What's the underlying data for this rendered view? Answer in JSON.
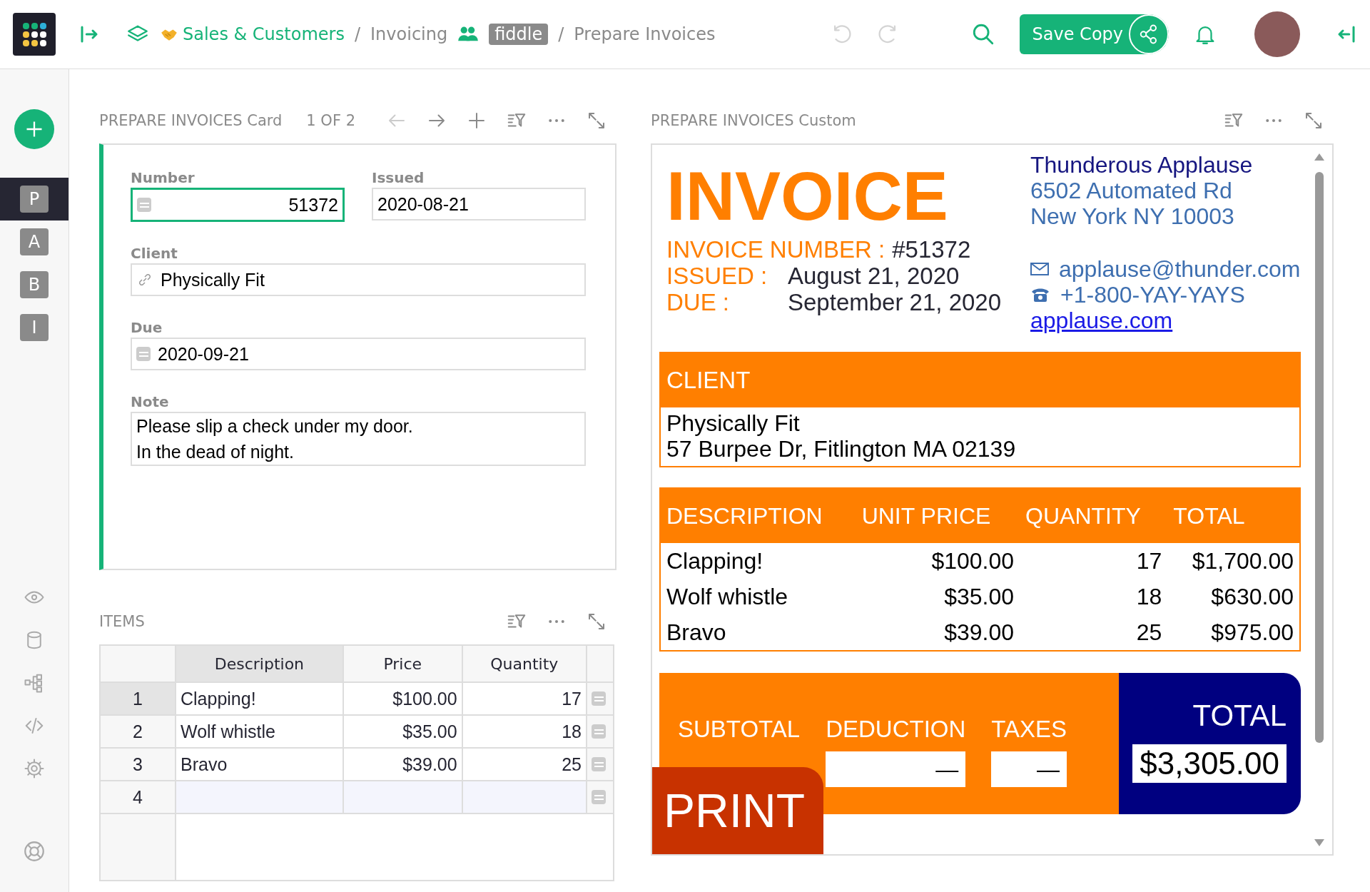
{
  "topbar": {
    "breadcrumb": [
      {
        "kind": "site",
        "text": "Sales & Customers"
      },
      {
        "kind": "separator",
        "text": "/"
      },
      {
        "kind": "link",
        "text": "Invoicing"
      },
      {
        "kind": "workspace",
        "text": "fiddle"
      },
      {
        "kind": "separator",
        "text": "/"
      },
      {
        "kind": "page",
        "text": "Prepare Invoices"
      }
    ],
    "undo_disabled": true,
    "redo_disabled": true,
    "save_button": "Save Copy"
  },
  "sidebar": {
    "pages": [
      {
        "letter": "P",
        "selected": true
      },
      {
        "letter": "A",
        "selected": false
      },
      {
        "letter": "B",
        "selected": false
      },
      {
        "letter": "I",
        "selected": false
      }
    ]
  },
  "card": {
    "title": "PREPARE INVOICES Card",
    "counter": "1 OF 2",
    "back_disabled": true,
    "fields": [
      {
        "label": "Number",
        "value": "51372",
        "kind": "numeric",
        "selected": true
      },
      {
        "label": "Issued",
        "value": "2020-08-21",
        "kind": "plain",
        "selected": false
      },
      {
        "label": "Client",
        "value": "Physically Fit",
        "kind": "reference",
        "selected": false
      },
      {
        "label": "Due",
        "value": "2020-09-21",
        "kind": "date",
        "selected": false
      },
      {
        "label": "Note",
        "value": "Please slip a check under my door.\nIn the dead of night.",
        "kind": "plain",
        "selected": false
      }
    ]
  },
  "items": {
    "title": "ITEMS",
    "columns": [
      {
        "label": "Description",
        "selected": true
      },
      {
        "label": "Price",
        "selected": false
      },
      {
        "label": "Quantity",
        "selected": false
      }
    ],
    "rows": [
      {
        "number": "1",
        "kind": "record",
        "selected": true,
        "cells": [
          "Clapping!",
          "$100.00",
          "17"
        ]
      },
      {
        "number": "2",
        "kind": "record",
        "selected": false,
        "cells": [
          "Wolf whistle",
          "$35.00",
          "18"
        ]
      },
      {
        "number": "3",
        "kind": "record",
        "selected": false,
        "cells": [
          "Bravo",
          "$39.00",
          "25"
        ]
      },
      {
        "number": "4",
        "kind": "new",
        "selected": false
      }
    ]
  },
  "custom": {
    "title": "PREPARE INVOICES Custom",
    "invoice": {
      "title": "INVOICE",
      "meta": [
        {
          "label": "INVOICE NUMBER :",
          "value": "#51372"
        },
        {
          "label": "ISSUED :",
          "value": "August 21, 2020"
        },
        {
          "label": "DUE :",
          "value": "September 21, 2020"
        }
      ],
      "company": {
        "name": "Thunderous Applause",
        "address": [
          "6502 Automated Rd",
          "New York NY 10003"
        ],
        "email": "applause@thunder.com",
        "phone": "+1-800-YAY-YAYS",
        "website": "applause.com"
      },
      "client": {
        "heading": "CLIENT",
        "lines": [
          "Physically Fit",
          "57 Burpee Dr, Fitlington MA 02139"
        ]
      },
      "table": {
        "columns": [
          "DESCRIPTION",
          "UNIT PRICE",
          "QUANTITY",
          "TOTAL"
        ],
        "rows": [
          [
            "Clapping!",
            "$100.00",
            "17",
            "$1,700.00"
          ],
          [
            "Wolf whistle",
            "$35.00",
            "18",
            "$630.00"
          ],
          [
            "Bravo",
            "$39.00",
            "25",
            "$975.00"
          ]
        ]
      },
      "totals": {
        "fields": [
          {
            "label": "SUBTOTAL"
          },
          {
            "label": "DEDUCTION",
            "value": "—"
          },
          {
            "label": "TAXES",
            "value": "—"
          }
        ],
        "total_label": "TOTAL",
        "total": "$3,305.00"
      },
      "print_button": "PRINT"
    }
  }
}
